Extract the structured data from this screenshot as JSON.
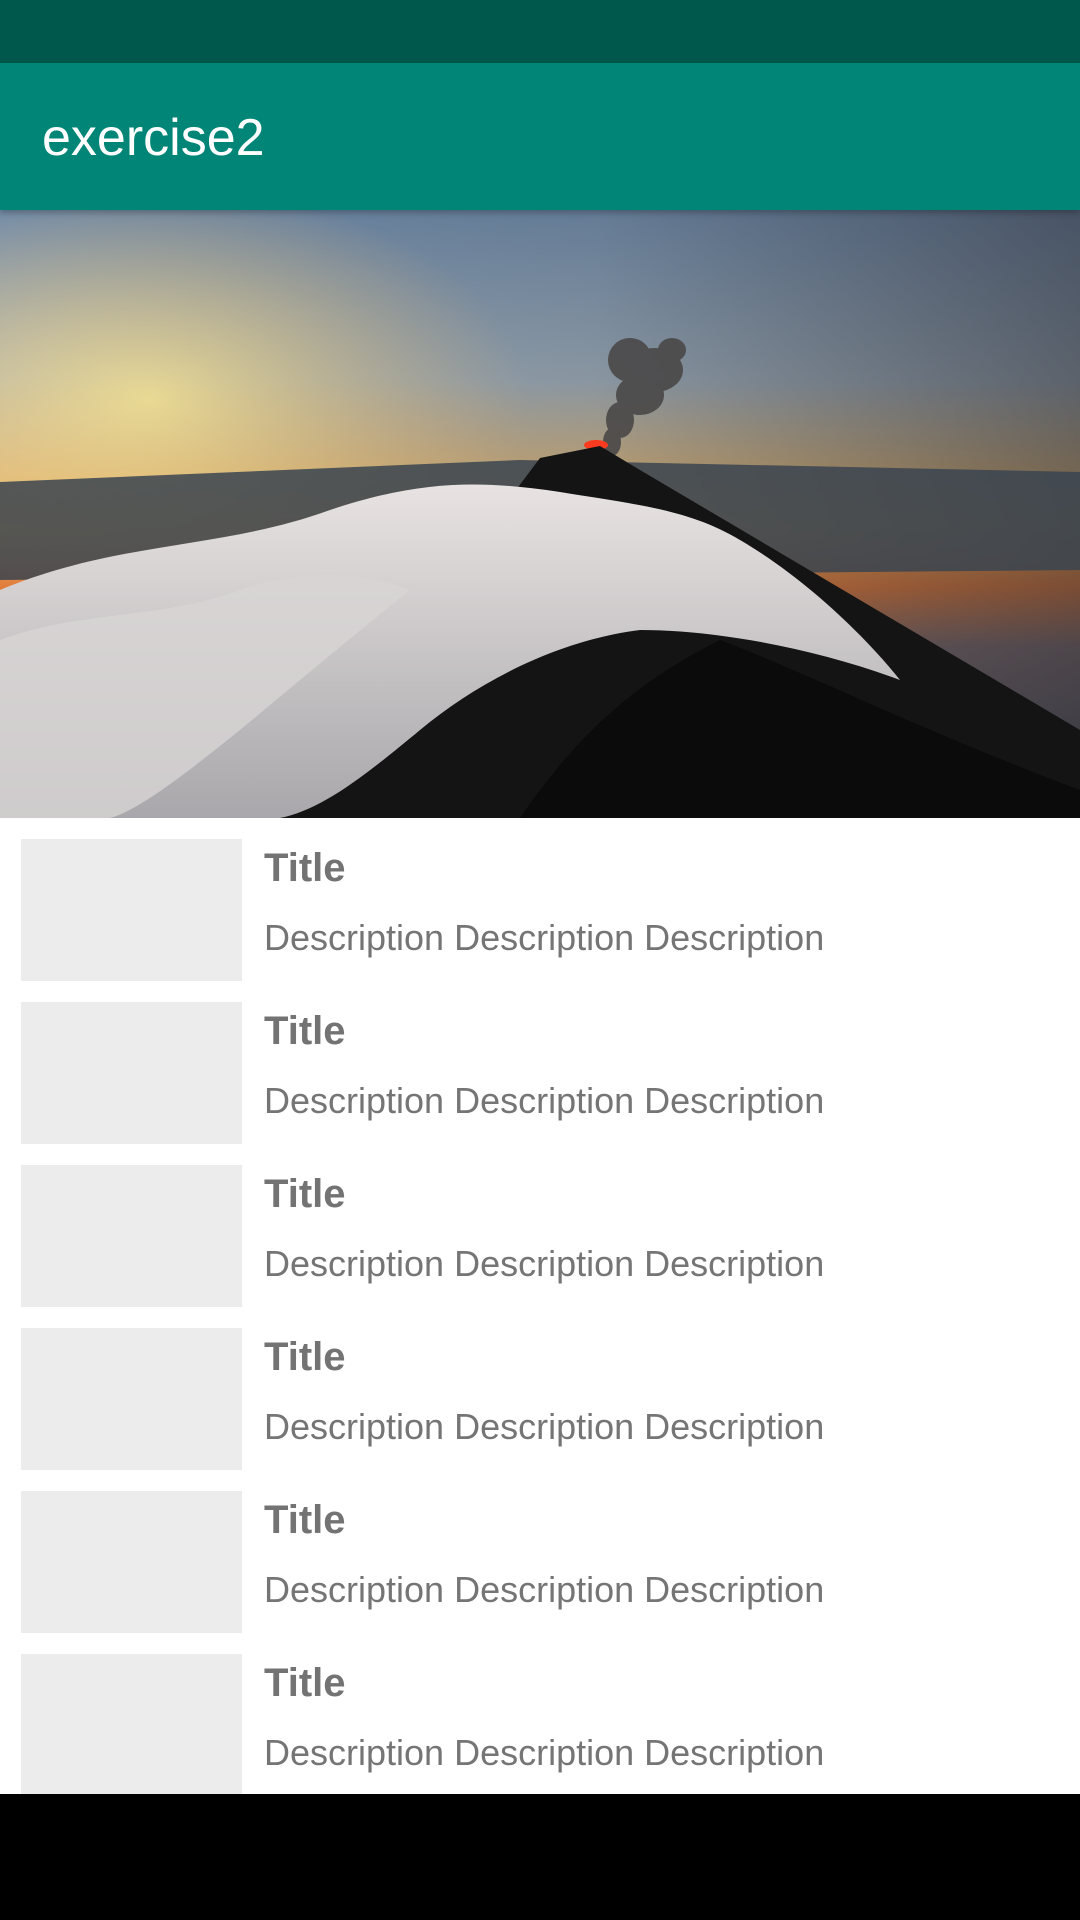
{
  "app_bar": {
    "title": "exercise2",
    "color": "#008577"
  },
  "status_bar": {
    "color": "#00574b"
  },
  "hero": {
    "subject": "volcano erupting above clouds at sunset"
  },
  "list": {
    "items": [
      {
        "title": "Title",
        "description": "Description Description Description"
      },
      {
        "title": "Title",
        "description": "Description Description Description"
      },
      {
        "title": "Title",
        "description": "Description Description Description"
      },
      {
        "title": "Title",
        "description": "Description Description Description"
      },
      {
        "title": "Title",
        "description": "Description Description Description"
      },
      {
        "title": "Title",
        "description": "Description Description Description"
      }
    ]
  }
}
